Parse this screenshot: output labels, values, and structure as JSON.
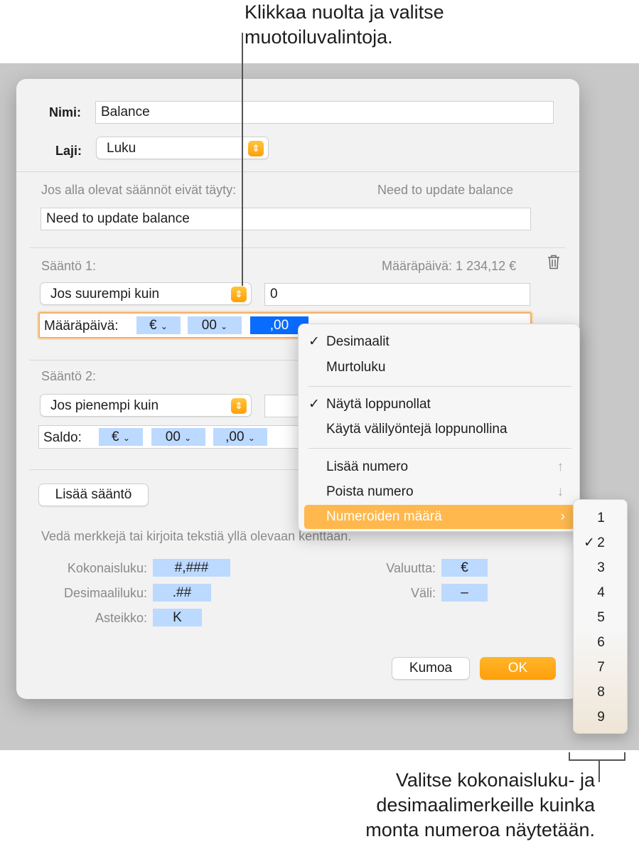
{
  "callouts": {
    "top_line1": "Klikkaa nuolta ja valitse",
    "top_line2": "muotoiluvalintoja.",
    "bottom_line1": "Valitse kokonaisluku- ja",
    "bottom_line2": "desimaalimerkeille kuinka",
    "bottom_line3": "monta numeroa näytetään."
  },
  "dialog": {
    "name_label": "Nimi:",
    "name_value": "Balance",
    "type_label": "Laji:",
    "type_value": "Luku",
    "fallback_label": "Jos alla olevat säännöt eivät täyty:",
    "fallback_preview": "Need to update balance",
    "fallback_value": "Need to update balance",
    "rule1": {
      "title": "Sääntö 1:",
      "preview": "Määräpäivä: 1 234,12 €",
      "condition": "Jos suurempi kuin",
      "value": "0",
      "format_label": "Määräpäivä:",
      "token_currency": "€",
      "token_integer": "00",
      "token_decimal": ",00"
    },
    "rule2": {
      "title": "Sääntö 2:",
      "condition": "Jos pienempi kuin",
      "format_label": "Saldo:",
      "token_currency": "€",
      "token_integer": "00",
      "token_decimal": ",00"
    },
    "add_rule": "Lisää sääntö",
    "hint": "Vedä merkkejä tai kirjoita tekstiä yllä olevaan kenttään.",
    "palette": {
      "integer_label": "Kokonaisluku:",
      "integer_token": "#,###",
      "decimal_label": "Desimaaliluku:",
      "decimal_token": ".##",
      "scale_label": "Asteikko:",
      "scale_token": "K",
      "currency_label": "Valuutta:",
      "currency_token": "€",
      "space_label": "Väli:",
      "space_token": "–"
    },
    "cancel": "Kumoa",
    "ok": "OK"
  },
  "menu": {
    "items": [
      {
        "label": "Desimaalit",
        "check": "✓"
      },
      {
        "label": "Murtoluku",
        "check": ""
      },
      {
        "label": "Näytä loppunollat",
        "check": "✓"
      },
      {
        "label": "Käytä välilyöntejä loppunollina",
        "check": ""
      },
      {
        "label": "Lisää numero",
        "shortcut": "↑"
      },
      {
        "label": "Poista numero",
        "shortcut": "↓"
      },
      {
        "label": "Numeroiden määrä",
        "chevron": "›"
      }
    ]
  },
  "submenu": {
    "items": [
      "1",
      "2",
      "3",
      "4",
      "5",
      "6",
      "7",
      "8",
      "9"
    ],
    "selected_check": "✓"
  },
  "icons": {
    "trash": "trash-icon",
    "stepper": "chevron-up-down-icon",
    "chevron_down": "chevron-down-icon"
  },
  "colors": {
    "accent": "#ff9f0a",
    "token": "#bcd9ff",
    "token_selected": "#0a6cff",
    "menu_highlight": "#ffb84d"
  }
}
